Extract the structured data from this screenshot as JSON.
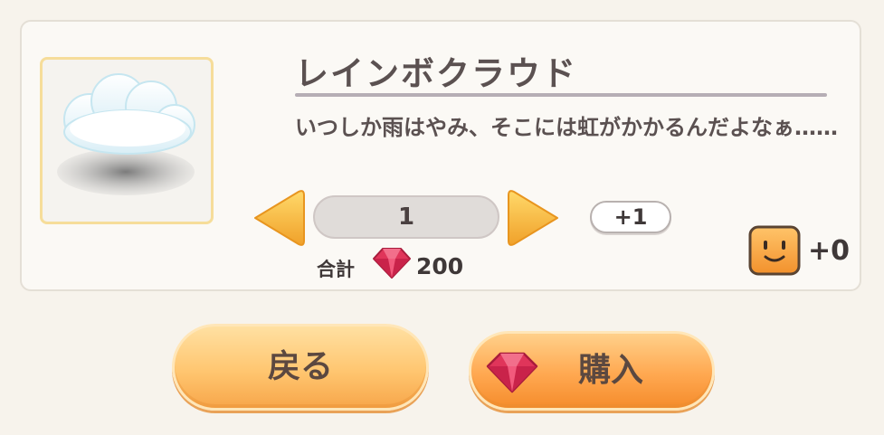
{
  "item": {
    "name": "レインボクラウド",
    "description": "いつしか雨はやみ、そこには虹がかかるんだよなぁ……",
    "icon": "cloud-icon"
  },
  "purchase": {
    "quantity": "1",
    "increment_label": "+1",
    "total_label": "合計",
    "total_value": "200",
    "currency_icon": "ruby-gem-icon"
  },
  "reward": {
    "icon": "smiley-face-icon",
    "count": "+0"
  },
  "buttons": {
    "back_label": "戻る",
    "buy_label": "購入"
  },
  "colors": {
    "button_orange": "#ffc670",
    "gem_red": "#e0355a",
    "frame_gold": "#f6dd9a"
  }
}
